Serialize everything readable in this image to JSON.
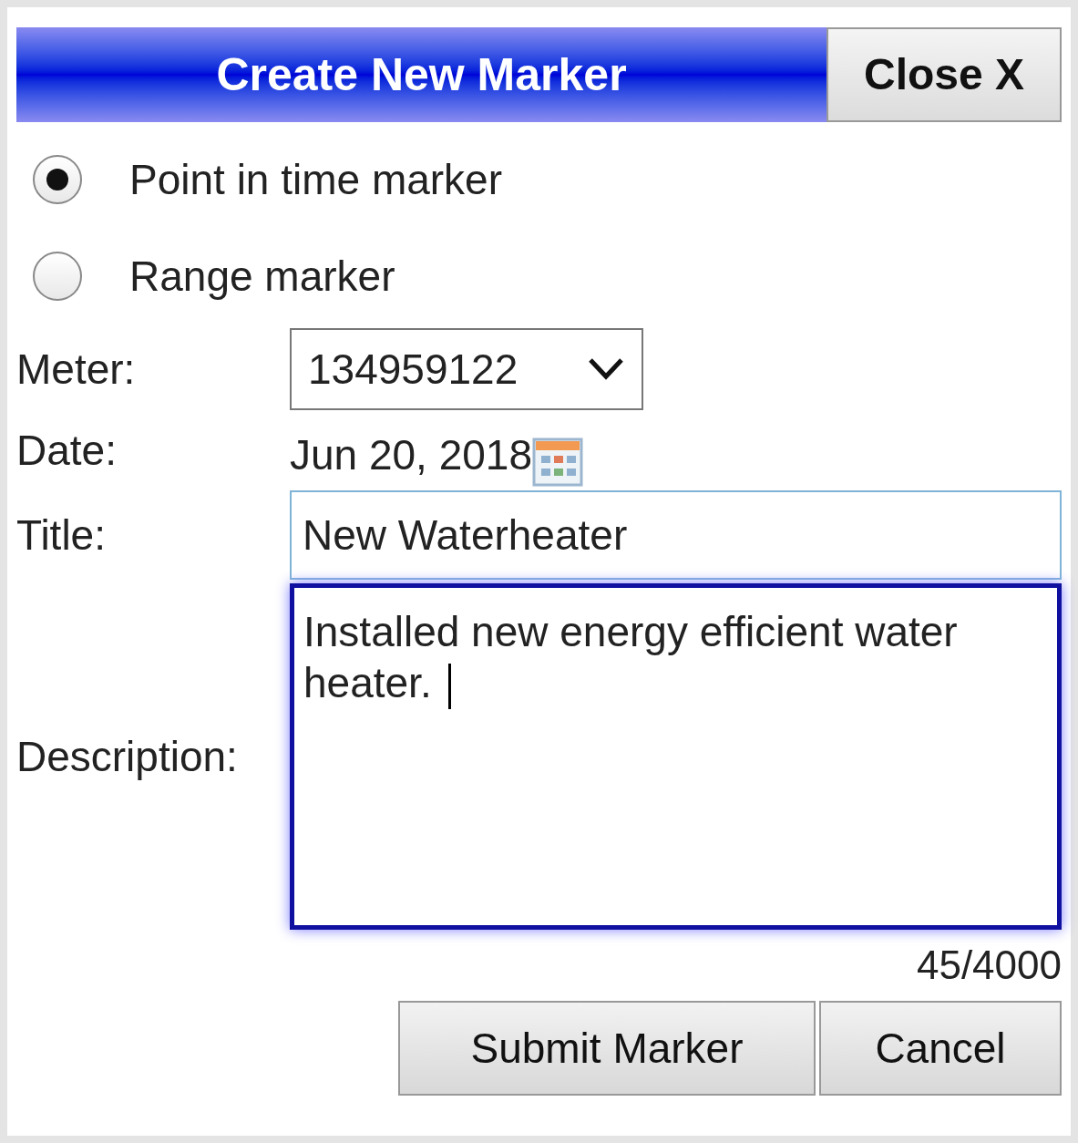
{
  "dialog": {
    "title": "Create New Marker",
    "close_button": "Close X"
  },
  "marker_types": [
    {
      "label": "Point in time marker",
      "selected": true
    },
    {
      "label": "Range marker",
      "selected": false
    }
  ],
  "fields": [
    {
      "kind": "select",
      "label": "Meter:",
      "value": "134959122"
    },
    {
      "kind": "date",
      "label": "Date:",
      "value": "Jun 20, 2018"
    },
    {
      "kind": "text",
      "label": "Title:",
      "value": "New Waterheater"
    },
    {
      "kind": "textarea",
      "label": "Description:",
      "value": "Installed new energy efficient water heater."
    }
  ],
  "char_count": "45/4000",
  "buttons": [
    "Submit Marker",
    "Cancel"
  ]
}
